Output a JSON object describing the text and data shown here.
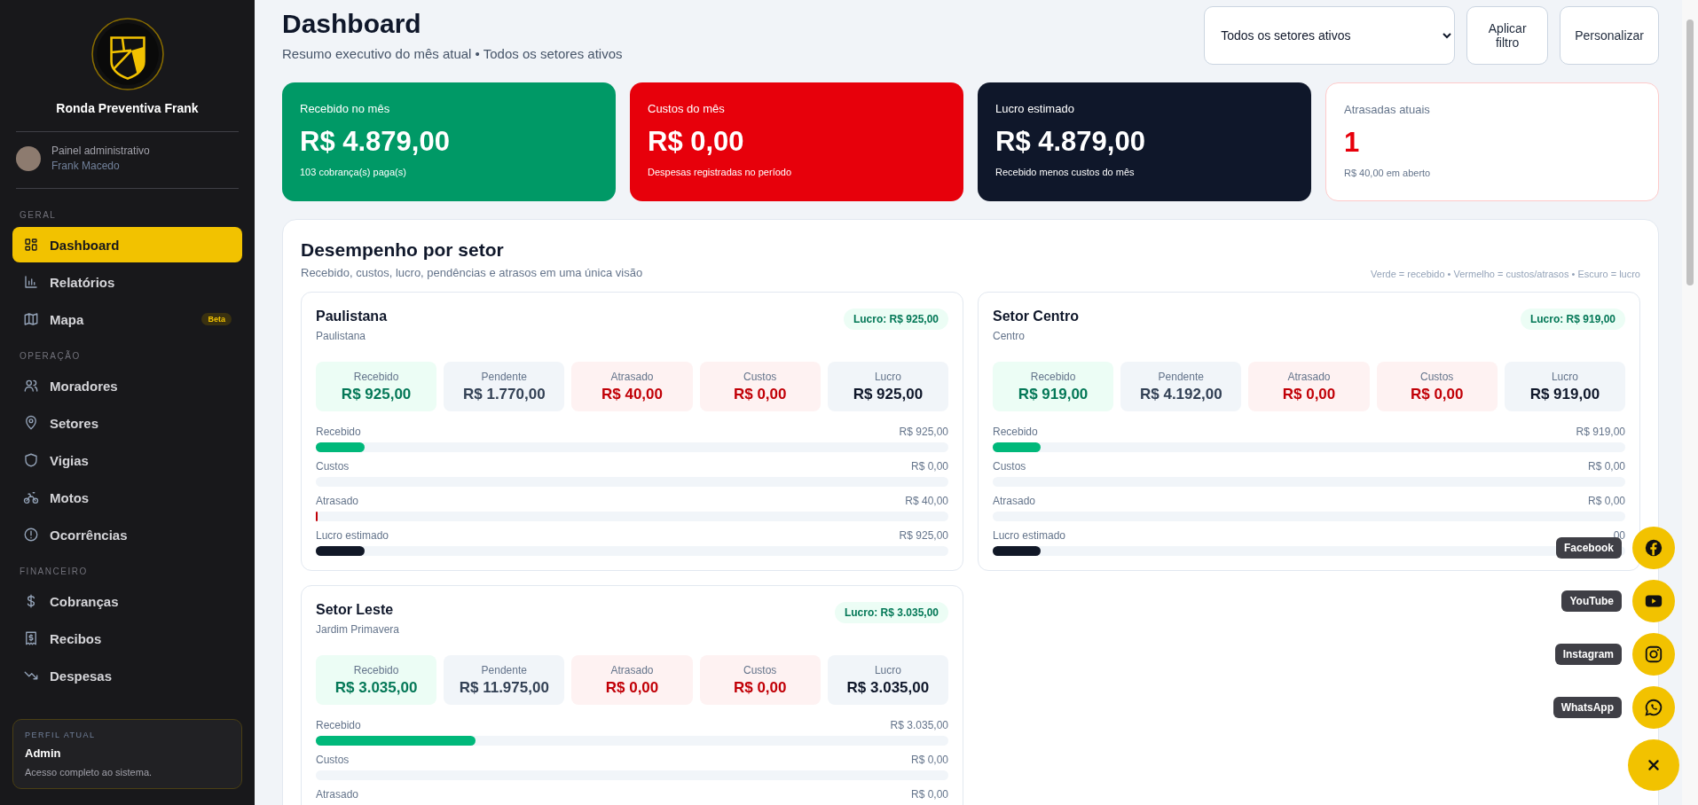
{
  "sidebar": {
    "brand": "Ronda Preventiva Frank",
    "user": {
      "role": "Painel administrativo",
      "name": "Frank Macedo"
    },
    "sections": [
      {
        "title": "GERAL",
        "items": [
          {
            "label": "Dashboard",
            "selected": true
          },
          {
            "label": "Relatórios",
            "selected": false
          },
          {
            "label": "Mapa",
            "selected": false,
            "badge": "Beta"
          }
        ]
      },
      {
        "title": "OPERAÇÃO",
        "items": [
          {
            "label": "Moradores",
            "selected": false
          },
          {
            "label": "Setores",
            "selected": false
          },
          {
            "label": "Vigias",
            "selected": false
          },
          {
            "label": "Motos",
            "selected": false
          },
          {
            "label": "Ocorrências",
            "selected": false
          }
        ]
      },
      {
        "title": "FINANCEIRO",
        "items": [
          {
            "label": "Cobranças",
            "selected": false
          },
          {
            "label": "Recibos",
            "selected": false
          },
          {
            "label": "Despesas",
            "selected": false
          }
        ]
      }
    ],
    "profile": {
      "caption": "PERFIL ATUAL",
      "name": "Admin",
      "description": "Acesso completo ao sistema."
    }
  },
  "header": {
    "title": "Dashboard",
    "subtitle": "Resumo executivo do mês atual • Todos os setores ativos",
    "filter": "Todos os setores ativos",
    "buttons": [
      "Aplicar filtro",
      "Personalizar"
    ]
  },
  "kpis": [
    {
      "kind": "green",
      "label": "Recebido no mês",
      "value": "R$ 4.879,00",
      "note": "103 cobrança(s) paga(s)"
    },
    {
      "kind": "red",
      "label": "Custos do mês",
      "value": "R$ 0,00",
      "note": "Despesas registradas no período"
    },
    {
      "kind": "dark",
      "label": "Lucro estimado",
      "value": "R$ 4.879,00",
      "note": "Recebido menos custos do mês"
    },
    {
      "kind": "outline",
      "label": "Atrasadas atuais",
      "value": "1",
      "note": "R$ 40,00 em aberto"
    }
  ],
  "performance": {
    "title": "Desempenho por setor",
    "subtitle": "Recebido, custos, lucro, pendências e atrasos em uma única visão",
    "legend": "Verde = recebido • Vermelho = custos/atrasos • Escuro = lucro",
    "sectors": [
      {
        "name": "Paulistana",
        "district": "Paulistana",
        "profit_badge": "Lucro: R$ 925,00",
        "tiles": [
          {
            "kind": "received",
            "label": "Recebido",
            "value": "R$ 925,00"
          },
          {
            "kind": "pending",
            "label": "Pendente",
            "value": "R$ 1.770,00"
          },
          {
            "kind": "late",
            "label": "Atrasado",
            "value": "R$ 40,00"
          },
          {
            "kind": "costs",
            "label": "Custos",
            "value": "R$ 0,00"
          },
          {
            "kind": "profit",
            "label": "Lucro",
            "value": "R$ 925,00"
          }
        ],
        "bars": [
          {
            "kind": "received",
            "label": "Recebido",
            "value": "R$ 925,00",
            "level": 0.077
          },
          {
            "kind": "costs",
            "label": "Custos",
            "value": "R$ 0,00",
            "level": 0
          },
          {
            "kind": "late",
            "label": "Atrasado",
            "value": "R$ 40,00",
            "level": 0.003
          },
          {
            "kind": "profit",
            "label": "Lucro estimado",
            "value": "R$ 925,00",
            "level": 0.077
          }
        ]
      },
      {
        "name": "Setor Centro",
        "district": "Centro",
        "profit_badge": "Lucro: R$ 919,00",
        "tiles": [
          {
            "kind": "received",
            "label": "Recebido",
            "value": "R$ 919,00"
          },
          {
            "kind": "pending",
            "label": "Pendente",
            "value": "R$ 4.192,00"
          },
          {
            "kind": "late",
            "label": "Atrasado",
            "value": "R$ 0,00"
          },
          {
            "kind": "costs",
            "label": "Custos",
            "value": "R$ 0,00"
          },
          {
            "kind": "profit",
            "label": "Lucro",
            "value": "R$ 919,00"
          }
        ],
        "bars": [
          {
            "kind": "received",
            "label": "Recebido",
            "value": "R$ 919,00",
            "level": 0.076
          },
          {
            "kind": "costs",
            "label": "Custos",
            "value": "R$ 0,00",
            "level": 0
          },
          {
            "kind": "late",
            "label": "Atrasado",
            "value": "R$ 0,00",
            "level": 0
          },
          {
            "kind": "profit",
            "label": "Lucro estimado",
            "value": "00",
            "level": 0.076
          }
        ]
      },
      {
        "name": "Setor Leste",
        "district": "Jardim Primavera",
        "profit_badge": "Lucro: R$ 3.035,00",
        "tiles": [
          {
            "kind": "received",
            "label": "Recebido",
            "value": "R$ 3.035,00"
          },
          {
            "kind": "pending",
            "label": "Pendente",
            "value": "R$ 11.975,00"
          },
          {
            "kind": "late",
            "label": "Atrasado",
            "value": "R$ 0,00"
          },
          {
            "kind": "costs",
            "label": "Custos",
            "value": "R$ 0,00"
          },
          {
            "kind": "profit",
            "label": "Lucro",
            "value": "R$ 3.035,00"
          }
        ],
        "bars": [
          {
            "kind": "received",
            "label": "Recebido",
            "value": "R$ 3.035,00",
            "level": 0.253
          },
          {
            "kind": "costs",
            "label": "Custos",
            "value": "R$ 0,00",
            "level": 0
          },
          {
            "label": "Atrasado",
            "value": "R$ 0,00"
          }
        ]
      }
    ]
  },
  "social": [
    "Facebook",
    "YouTube",
    "Instagram",
    "WhatsApp"
  ]
}
